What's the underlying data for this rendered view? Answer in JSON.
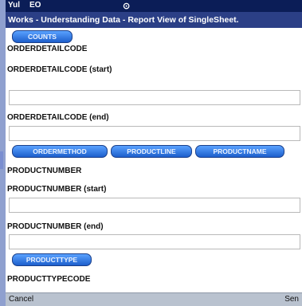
{
  "status": {
    "signal": "Yul",
    "network": "EO",
    "icon": "compass-icon"
  },
  "window": {
    "title": "Works - Understanding Data - Report View of SingleSheet."
  },
  "buttons": {
    "counts": "COUNTS",
    "ordermethod": "ORDERMETHOD",
    "productline": "PRODUCTLINE",
    "productname": "PRODUCTNAME",
    "producttype": "PRODUCTTYPE"
  },
  "fields": {
    "orderdetailcode_label": "ORDERDETAILCODE",
    "orderdetailcode_start_label": "ORDERDETAILCODE (start)",
    "orderdetailcode_start_value": "",
    "orderdetailcode_end_label": "ORDERDETAILCODE (end)",
    "orderdetailcode_end_value": "",
    "productnumber_label": "PRODUCTNUMBER",
    "productnumber_start_label": "PRODUCTNUMBER (start)",
    "productnumber_start_value": "",
    "productnumber_end_label": "PRODUCTNUMBER (end)",
    "productnumber_end_value": "",
    "producttypecode_label": "PRODUCTTYPECODE"
  },
  "softkeys": {
    "left": "Cancel",
    "right": "Sen"
  },
  "colors": {
    "status_bar": "#0b1d57",
    "title_bar": "#2b3f86",
    "pill": "#1d5fcc",
    "background": "#8fa0cf"
  }
}
